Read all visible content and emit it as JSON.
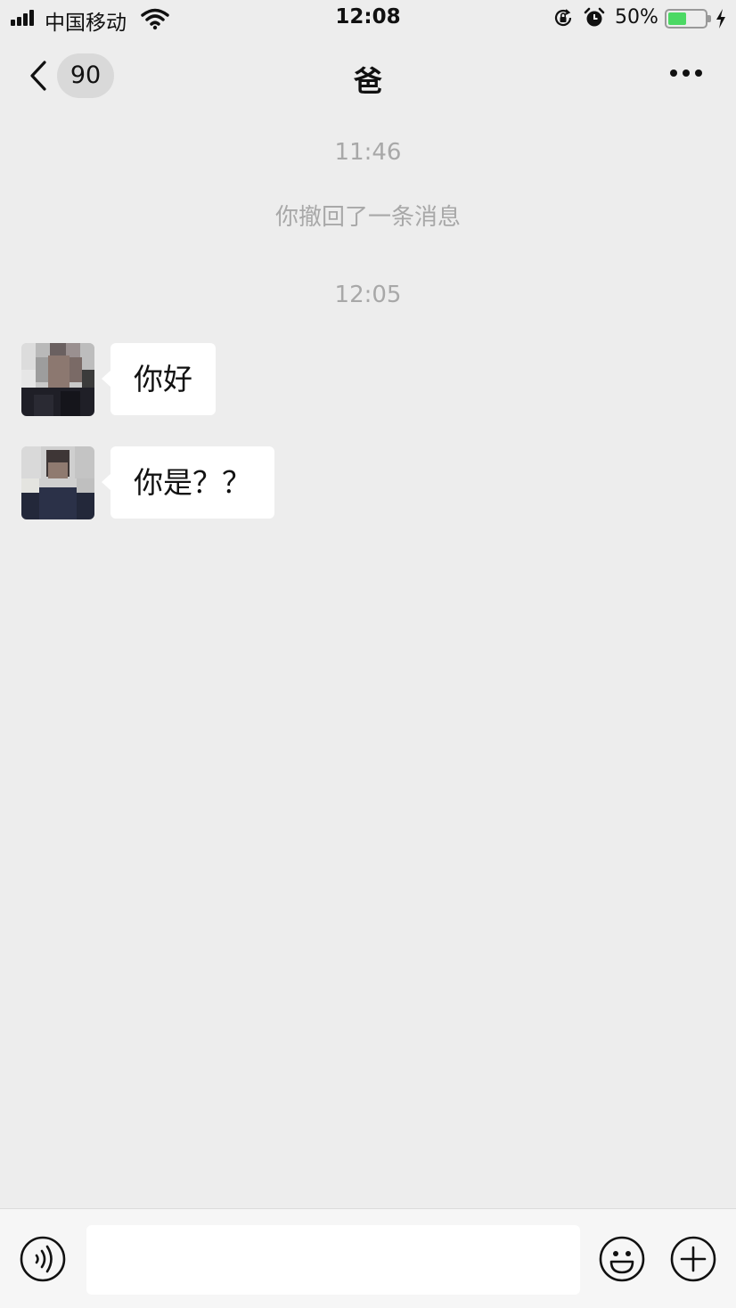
{
  "status_bar": {
    "carrier": "中国移动",
    "time": "12:08",
    "battery_percent": "50%",
    "battery_level": 0.5,
    "battery_color": "#4cd964"
  },
  "nav": {
    "unread_count": "90",
    "title": "爸",
    "more_icon": "ellipsis-icon",
    "back_icon": "chevron-left-icon"
  },
  "messages": {
    "time_1": "11:46",
    "recall_notice": "你撤回了一条消息",
    "time_2": "12:05",
    "items": [
      {
        "sender": "contact",
        "text": "你好"
      },
      {
        "sender": "contact",
        "text": "你是？？"
      }
    ]
  },
  "input_bar": {
    "voice_icon": "voice-icon",
    "input_value": "",
    "emoji_icon": "emoji-icon",
    "plus_icon": "plus-circle-icon"
  },
  "colors": {
    "background": "#ededed",
    "bubble": "#ffffff",
    "meta_text": "#a8a8a8"
  }
}
